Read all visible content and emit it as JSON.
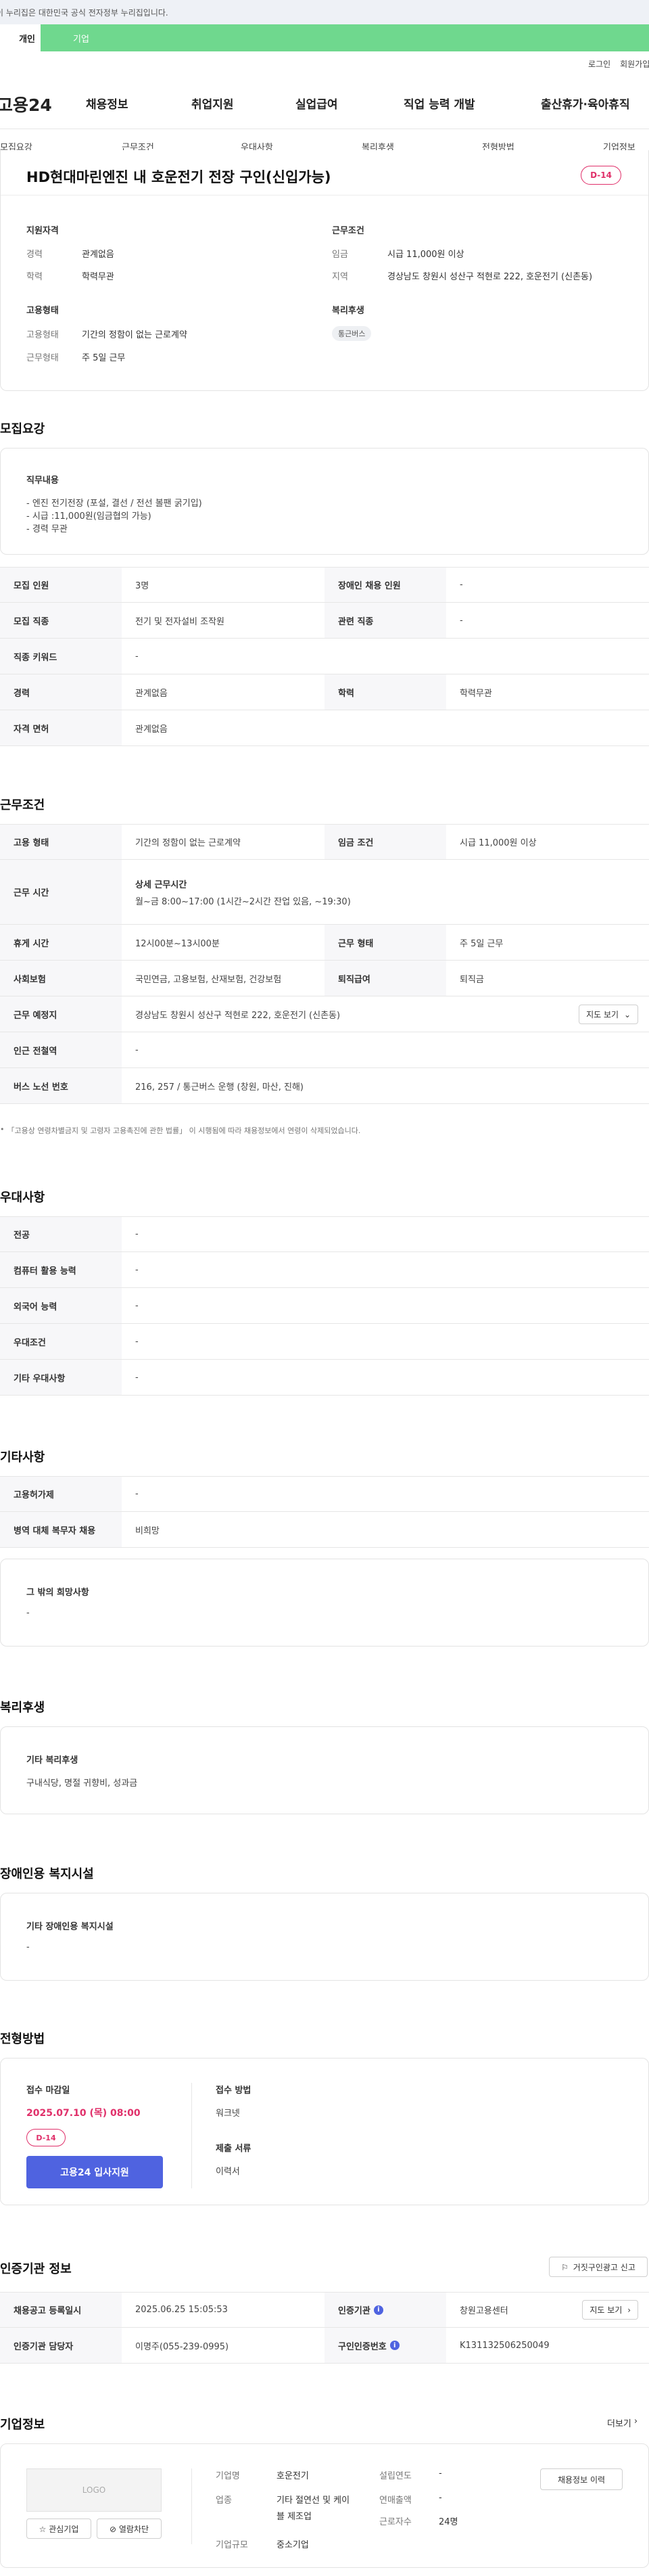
{
  "gov_banner": {
    "text": "이 누리집은 대한민국 공식 전자정부 누리집입니다."
  },
  "user_tabs": {
    "personal": "개인",
    "company": "기업"
  },
  "util": {
    "login": "로그인",
    "signup": "회원가입"
  },
  "gnb": {
    "logo": "고용24",
    "menu": [
      "채용정보",
      "취업지원",
      "실업급여",
      "직업 능력 개발",
      "출산휴가·육아휴직"
    ]
  },
  "anchor_tabs": [
    "모집요강",
    "근무조건",
    "우대사항",
    "복리후생",
    "전형방법",
    "기업정보"
  ],
  "summary": {
    "title": "HD현대마린엔진 내 호운전기 전장 구인(신입가능)",
    "dday": "D-14",
    "qualification": {
      "title": "지원자격",
      "career_label": "경력",
      "career_value": "관계없음",
      "edu_label": "학력",
      "edu_value": "학력무관"
    },
    "work_conditions": {
      "title": "근무조건",
      "wage_label": "임금",
      "wage_value": "시급 11,000원 이상",
      "region_label": "지역",
      "region_value": "경상남도 창원시 성산구 적현로 222, 호운전기 (신촌동)"
    },
    "employment": {
      "title": "고용형태",
      "type_label": "고용형태",
      "type_value": "기간의 정함이 없는 근로계약",
      "shape_label": "근무형태",
      "shape_value": "주 5일 근무"
    },
    "welfare": {
      "title": "복리후생",
      "tag": "통근버스"
    }
  },
  "recruit": {
    "section_title": "모집요강",
    "duty_title": "직무내용",
    "duty_lines": [
      "- 엔진 전기전장 (포설, 결선 / 전선 볼팬 굵기입)",
      "- 시급 :11,000원(임금협의 가능)",
      "- 경력 무관"
    ],
    "rows": [
      {
        "k1": "모집 인원",
        "v1": "3명",
        "k2": "장애인 채용 인원",
        "v2": "-"
      },
      {
        "k1": "모집 직종",
        "v1": "전기 및 전자설비 조작원",
        "k2": "관련 직종",
        "v2": "-"
      },
      {
        "k1": "직종 키워드",
        "v1": "-"
      },
      {
        "k1": "경력",
        "v1": "관계없음",
        "k2": "학력",
        "v2": "학력무관"
      },
      {
        "k1": "자격 면허",
        "v1": "관계없음"
      }
    ]
  },
  "conditions": {
    "section_title": "근무조건",
    "emp_type_k": "고용 형태",
    "emp_type_v": "기간의 정함이 없는 근로계약",
    "wage_k": "임금 조건",
    "wage_v": "시급 11,000원 이상",
    "hours_k": "근무 시간",
    "hours_sub": "상세 근무시간",
    "hours_v": "월~금 8:00~17:00 (1시간~2시간 잔업 있음, ~19:30)",
    "rest_k": "휴게 시간",
    "rest_v": "12시00분~13시00분",
    "shape_k": "근무 형태",
    "shape_v": "주 5일 근무",
    "ins_k": "사회보험",
    "ins_v": "국민연금, 고용보험, 산재보험, 건강보험",
    "retire_k": "퇴직급여",
    "retire_v": "퇴직금",
    "loc_k": "근무 예정지",
    "loc_v": "경상남도 창원시 성산구 적현로 222, 호운전기 (신촌동)",
    "map_btn": "지도 보기",
    "subway_k": "인근 전철역",
    "subway_v": "-",
    "bus_k": "버스 노선 번호",
    "bus_v": "216, 257 / 통근버스 운행 (창원, 마산, 진해)",
    "footnote": "「고용상 연령차별금지 및 고령자 고용촉진에 관한 법률」 이 시행됨에 따라 채용정보에서 연령이 삭제되었습니다."
  },
  "preference": {
    "section_title": "우대사항",
    "rows": [
      {
        "k": "전공",
        "v": "-"
      },
      {
        "k": "컴퓨터 활용 능력",
        "v": "-"
      },
      {
        "k": "외국어 능력",
        "v": "-"
      },
      {
        "k": "우대조건",
        "v": "-"
      },
      {
        "k": "기타 우대사항",
        "v": "-"
      }
    ]
  },
  "etc": {
    "section_title": "기타사항",
    "rows": [
      {
        "k": "고용허가제",
        "v": "-"
      },
      {
        "k": "병역 대체 복무자 채용",
        "v": "비희망"
      }
    ],
    "other_title": "그 밖의 희망사항",
    "other_value": "-"
  },
  "welfare": {
    "section_title": "복리후생",
    "box_title": "기타 복리후생",
    "box_value": "구내식당, 명절 귀향비, 성과금"
  },
  "disability": {
    "section_title": "장애인용 복지시설",
    "box_title": "기타 장애인용 복지시설",
    "box_value": "-"
  },
  "selection": {
    "section_title": "전형방법",
    "deadline_label": "접수 마감일",
    "deadline_value": "2025.07.10 (목) 08:00",
    "dday": "D-14",
    "apply_btn": "고용24 입사지원",
    "method_label": "접수 방법",
    "method_value": "워크넷",
    "docs_label": "제출 서류",
    "docs_value": "이력서"
  },
  "cert": {
    "section_title": "인증기관 정보",
    "report_btn": "거짓구인광고 신고",
    "reg_k": "채용공고 등록일시",
    "reg_v": "2025.06.25 15:05:53",
    "agency_k": "인증기관",
    "agency_v": "창원고용센터",
    "map_btn": "지도 보기",
    "manager_k": "인증기관 담당자",
    "manager_v": "이명주(055-239-0995)",
    "cert_no_k": "구인인증번호",
    "cert_no_v": "K131132506250049"
  },
  "company": {
    "section_title": "기업정보",
    "more": "더보기",
    "logo_text": "LOGO",
    "interest_btn": "관심기업",
    "block_btn": "열람차단",
    "name_k": "기업명",
    "name_v": "호운전기",
    "industry_k": "업종",
    "industry_v": "기타 절연선 및 케이블 제조업",
    "size_k": "기업규모",
    "size_v": "중소기업",
    "founded_k": "설립연도",
    "founded_v": "-",
    "sales_k": "연매출액",
    "sales_v": "-",
    "employees_k": "근로자수",
    "employees_v": "24명",
    "history_btn": "채용정보 이력"
  },
  "colors": {
    "accent_green": "#6fd88e",
    "brand_blue": "#4f63e0",
    "dday_red": "#e0306a"
  }
}
